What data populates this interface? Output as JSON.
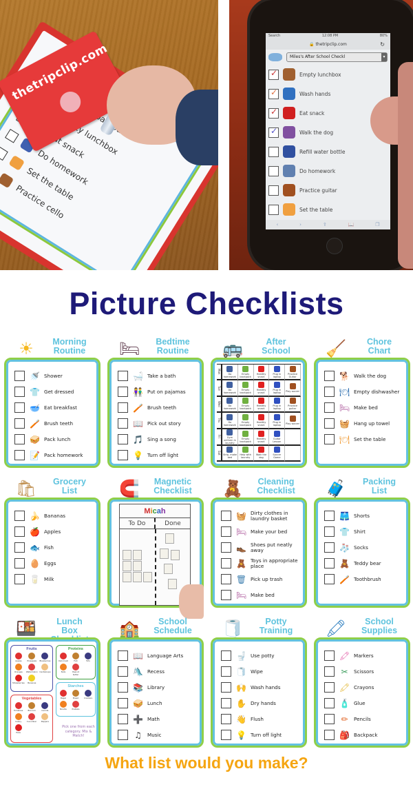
{
  "photos": {
    "clipboard": {
      "brand_text": "thetripclip.com",
      "items": [
        {
          "label": "Empty backpack",
          "checked": true
        },
        {
          "label": "Empty lunchbox",
          "checked": true
        },
        {
          "label": "Eat snack",
          "checked": true
        },
        {
          "label": "Do homework",
          "checked": false
        },
        {
          "label": "Set the table",
          "checked": false
        },
        {
          "label": "Practice cello",
          "checked": false
        }
      ]
    },
    "phone": {
      "status_carrier": "Search",
      "status_time": "12:08 PM",
      "status_battery": "80%",
      "url": "thetripclip.com",
      "list_select": "Miles's After School Checkl",
      "items": [
        {
          "label": "Empty lunchbox",
          "checked": true,
          "check_color": "#c83232"
        },
        {
          "label": "Wash hands",
          "checked": true,
          "check_color": "#e07040"
        },
        {
          "label": "Eat snack",
          "checked": true,
          "check_color": "#c83232"
        },
        {
          "label": "Walk the dog",
          "checked": true,
          "check_color": "#5050c8"
        },
        {
          "label": "Refill water bottle",
          "checked": false
        },
        {
          "label": "Do homework",
          "checked": false
        },
        {
          "label": "Practice guitar",
          "checked": false
        },
        {
          "label": "Set the table",
          "checked": false
        }
      ],
      "toolbar_icons": [
        "back-icon",
        "forward-icon",
        "share-icon",
        "bookmarks-icon",
        "tabs-icon"
      ]
    }
  },
  "title": "Picture Checklists",
  "colors": {
    "title": "#1e1a78",
    "tile_title": "#5ec3de",
    "card_outer_border": "#8fcf48",
    "card_inner_border": "#62c2e0",
    "tagline": "#f5a511"
  },
  "tiles": [
    {
      "key": "morning",
      "title_line1": "Morning",
      "title_line2": "Routine",
      "deco_icon": "sun-icon",
      "items": [
        {
          "label": "Shower",
          "icon": "shower-icon"
        },
        {
          "label": "Get dressed",
          "icon": "shirt-icon"
        },
        {
          "label": "Eat breakfast",
          "icon": "breakfast-icon"
        },
        {
          "label": "Brush teeth",
          "icon": "toothbrush-icon"
        },
        {
          "label": "Pack lunch",
          "icon": "lunch-icon"
        },
        {
          "label": "Pack homework",
          "icon": "homework-icon"
        }
      ]
    },
    {
      "key": "bedtime",
      "title_line1": "Bedtime",
      "title_line2": "Routine",
      "deco_icon": "bed-icon",
      "items": [
        {
          "label": "Take a bath",
          "icon": "bathtub-icon"
        },
        {
          "label": "Put on pajamas",
          "icon": "pajamas-icon"
        },
        {
          "label": "Brush teeth",
          "icon": "toothbrush-icon"
        },
        {
          "label": "Pick out story",
          "icon": "book-icon"
        },
        {
          "label": "Sing a song",
          "icon": "song-icon"
        },
        {
          "label": "Turn off light",
          "icon": "light-switch-icon"
        }
      ]
    },
    {
      "key": "afterschool",
      "title_line1": "After",
      "title_line2": "School",
      "deco_icon": "school-bus-icon",
      "grid": {
        "days": [
          "Mon",
          "Tue",
          "Wed",
          "Thu",
          "Fri",
          "Sat"
        ],
        "rows": [
          [
            "Do homework",
            "Empty backpack",
            "Healthy snack",
            "Plug in laptop",
            "Practice Guitar"
          ],
          [
            "Do homework",
            "Empty backpack",
            "Healthy snack",
            "Plug in laptop",
            "Play soccer"
          ],
          [
            "Do homework",
            "Empty backpack",
            "Healthy snack",
            "Plug in laptop",
            "Practice guitar"
          ],
          [
            "Do homework",
            "Empty backpack",
            "Healthy snack",
            "Plug in laptop",
            "Play soccer"
          ],
          [
            "Gym uniform in laundry",
            "Empty backpack",
            "Healthy snack",
            "Guitar Lesson",
            ""
          ],
          [
            "Strip, make bed",
            "Help with laundry",
            "Walk the dog",
            "Soccer Game",
            ""
          ]
        ]
      }
    },
    {
      "key": "chore",
      "title_line1": "Chore",
      "title_line2": "Chart",
      "deco_icon": "cleaning-person-icon",
      "items": [
        {
          "label": "Walk the dog",
          "icon": "dog-walk-icon"
        },
        {
          "label": "Empty dishwasher",
          "icon": "dishwasher-icon"
        },
        {
          "label": "Make bed",
          "icon": "bed-icon"
        },
        {
          "label": "Hang up towel",
          "icon": "towel-icon"
        },
        {
          "label": "Set the table",
          "icon": "plate-icon"
        }
      ]
    },
    {
      "key": "grocery",
      "title_line1": "Grocery",
      "title_line2": "List",
      "deco_icon": "grocery-bag-icon",
      "items": [
        {
          "label": "Bananas",
          "icon": "banana-icon"
        },
        {
          "label": "Apples",
          "icon": "apple-icon"
        },
        {
          "label": "Fish",
          "icon": "fish-icon"
        },
        {
          "label": "Eggs",
          "icon": "eggs-icon"
        },
        {
          "label": "Milk",
          "icon": "milk-icon"
        }
      ]
    },
    {
      "key": "magnetic",
      "title_line1": "Magnetic",
      "title_line2": "Checklist",
      "deco_icon": "magnet-icon",
      "board": {
        "name": "Micah",
        "col_todo": "To Do",
        "col_done": "Done"
      }
    },
    {
      "key": "cleaning",
      "title_line1": "Cleaning",
      "title_line2": "Checklist",
      "deco_icon": "toy-box-icon",
      "items": [
        {
          "label": "Dirty clothes in laundry basket",
          "icon": "laundry-icon"
        },
        {
          "label": "Make your bed",
          "icon": "bed-icon"
        },
        {
          "label": "Shoes put neatly away",
          "icon": "shoes-icon"
        },
        {
          "label": "Toys in appropriate place",
          "icon": "toys-icon"
        },
        {
          "label": "Pick up trash",
          "icon": "trash-can-icon"
        },
        {
          "label": "Make bed",
          "icon": "bed-icon"
        }
      ]
    },
    {
      "key": "packing",
      "title_line1": "Packing",
      "title_line2": "List",
      "deco_icon": "suitcase-icon",
      "items": [
        {
          "label": "Shorts",
          "icon": "shorts-icon"
        },
        {
          "label": "Shirt",
          "icon": "shirt-icon"
        },
        {
          "label": "Socks",
          "icon": "socks-icon"
        },
        {
          "label": "Teddy bear",
          "icon": "teddy-bear-icon"
        },
        {
          "label": "Toothbrush",
          "icon": "toothbrush-icon"
        }
      ]
    },
    {
      "key": "lunchbox",
      "title_line1": "Lunch Box",
      "title_line2": "Checklist",
      "deco_icon": "lunchbox-icon",
      "groups": {
        "fruits": {
          "title": "Fruits",
          "items": [
            "Apples",
            "Pineapple",
            "Blueberries",
            "Oranges",
            "Watermelon",
            "Cantaloupe",
            "Strawberries",
            "Bananas"
          ]
        },
        "proteins": {
          "title": "Proteins",
          "items": [
            "Deli meat",
            "Fish",
            "Tofu",
            "Nuts",
            "Peanut butter"
          ]
        },
        "starches": {
          "title": "Starches",
          "items": [
            "Bagel",
            "Bread",
            "Crackers",
            "Noodle",
            "Pretzels"
          ]
        },
        "vegetables": {
          "title": "Vegetables",
          "items": [
            "Tomatoes",
            "Broccoli",
            "Carrots",
            "Celery",
            "Cucumber",
            "Peppers",
            "Peas"
          ]
        }
      },
      "note": "Pick one from each category. Mix & Match!"
    },
    {
      "key": "school",
      "title_line1": "School",
      "title_line2": "Schedule",
      "deco_icon": "schoolhouse-icon",
      "items": [
        {
          "label": "Language Arts",
          "icon": "book-icon"
        },
        {
          "label": "Recess",
          "icon": "swing-icon"
        },
        {
          "label": "Library",
          "icon": "books-icon"
        },
        {
          "label": "Lunch",
          "icon": "lunch-icon"
        },
        {
          "label": "Math",
          "icon": "math-icon"
        },
        {
          "label": "Music",
          "icon": "music-notes-icon"
        }
      ]
    },
    {
      "key": "potty",
      "title_line1": "Potty",
      "title_line2": "Training",
      "deco_icon": "toilet-paper-icon",
      "items": [
        {
          "label": "Use potty",
          "icon": "toilet-icon"
        },
        {
          "label": "Wipe",
          "icon": "toilet-paper-icon"
        },
        {
          "label": "Wash hands",
          "icon": "wash-hands-icon"
        },
        {
          "label": "Dry hands",
          "icon": "dry-hands-icon"
        },
        {
          "label": "Flush",
          "icon": "flush-icon"
        },
        {
          "label": "Turn off light",
          "icon": "light-switch-icon"
        }
      ]
    },
    {
      "key": "supplies",
      "title_line1": "School",
      "title_line2": "Supplies",
      "deco_icon": "crayons-icon",
      "items": [
        {
          "label": "Markers",
          "icon": "markers-icon"
        },
        {
          "label": "Scissors",
          "icon": "scissors-icon"
        },
        {
          "label": "Crayons",
          "icon": "crayons-icon"
        },
        {
          "label": "Glue",
          "icon": "glue-icon"
        },
        {
          "label": "Pencils",
          "icon": "pencil-icon"
        },
        {
          "label": "Backpack",
          "icon": "backpack-icon"
        }
      ]
    }
  ],
  "tagline": "What list would you make?"
}
